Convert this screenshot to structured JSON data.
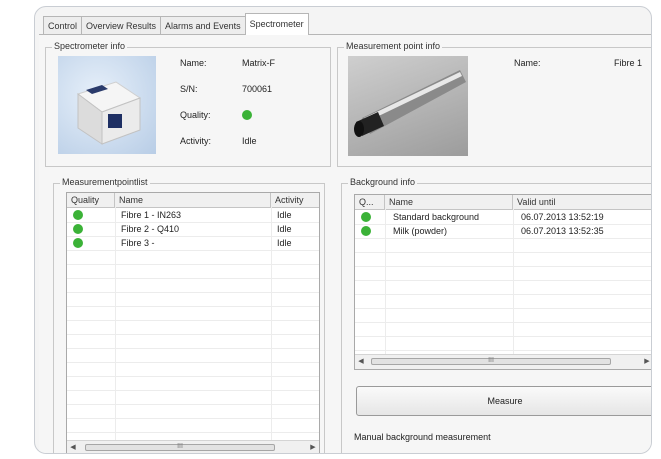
{
  "tabs": [
    {
      "label": "Control",
      "active": false
    },
    {
      "label": "Overview Results",
      "active": false
    },
    {
      "label": "Alarms and Events",
      "active": false
    },
    {
      "label": "Spectrometer",
      "active": true
    }
  ],
  "spectrometer_info": {
    "title": "Spectrometer info",
    "name_label": "Name:",
    "name_value": "Matrix-F",
    "sn_label": "S/N:",
    "sn_value": "700061",
    "quality_label": "Quality:",
    "activity_label": "Activity:",
    "activity_value": "Idle",
    "status_color": "#3bb237"
  },
  "measurement_point_info": {
    "title": "Measurement point info",
    "name_label": "Name:",
    "name_value": "Fibre 1"
  },
  "measurement_point_list": {
    "title": "Measurementpointlist",
    "columns": [
      "Quality",
      "Name",
      "Activity"
    ],
    "rows": [
      {
        "name": "Fibre 1 - IN263",
        "activity": "Idle"
      },
      {
        "name": "Fibre 2 - Q410",
        "activity": "Idle"
      },
      {
        "name": "Fibre 3 -",
        "activity": "Idle"
      }
    ],
    "scroll_grip": "III"
  },
  "background_info": {
    "title": "Background info",
    "columns": [
      "Q...",
      "Name",
      "Valid until"
    ],
    "rows": [
      {
        "name": "Standard background",
        "valid_until": "06.07.2013 13:52:19"
      },
      {
        "name": "Milk (powder)",
        "valid_until": "06.07.2013 13:52:35"
      }
    ],
    "scroll_grip": "III",
    "measure_button": "Measure",
    "status_text": "Manual background measurement"
  }
}
